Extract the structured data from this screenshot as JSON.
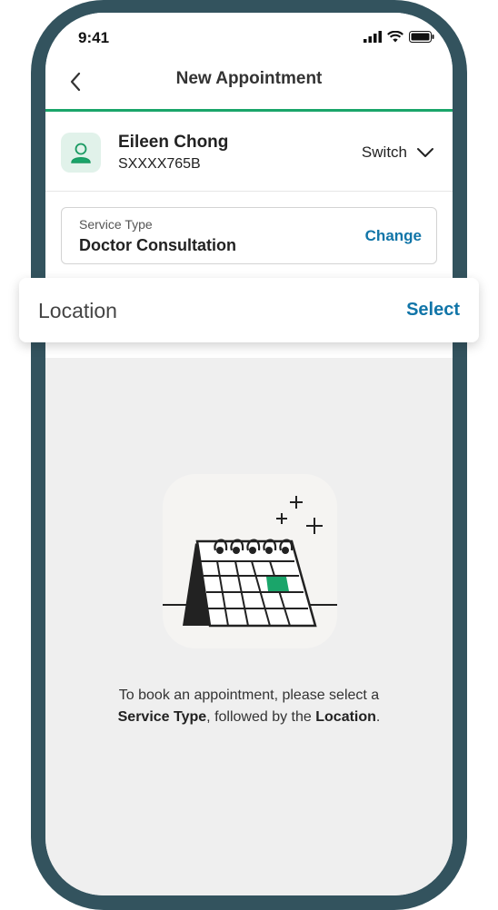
{
  "status_bar": {
    "time": "9:41"
  },
  "nav": {
    "title": "New Appointment"
  },
  "patient": {
    "name": "Eileen Chong",
    "id": "SXXXX765B",
    "switch_label": "Switch"
  },
  "service": {
    "label": "Service Type",
    "value": "Doctor Consultation",
    "action": "Change"
  },
  "location": {
    "label": "Location",
    "action": "Select"
  },
  "empty_state": {
    "line1": "To book an appointment, please select a",
    "bold1": "Service Type",
    "mid": ", followed by the ",
    "bold2": "Location",
    "end": "."
  },
  "colors": {
    "accent_green": "#1aa56a",
    "link_blue": "#1175a8",
    "frame": "#33535e"
  },
  "icons": [
    "back-chevron-icon",
    "signal-icon",
    "wifi-icon",
    "battery-icon",
    "user-icon",
    "chevron-down-icon",
    "calendar-illustration"
  ]
}
